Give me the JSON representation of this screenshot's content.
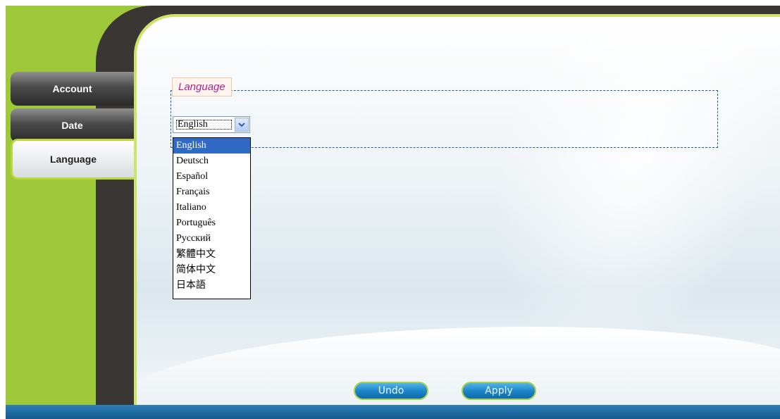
{
  "sidebar": {
    "tabs": [
      {
        "label": "Account",
        "active": false
      },
      {
        "label": "Date",
        "active": false
      },
      {
        "label": "Language",
        "active": true
      }
    ]
  },
  "language_section": {
    "legend": "Language",
    "select": {
      "selected_value": "English",
      "options": [
        "English",
        "Deutsch",
        "Español",
        "Français",
        "Italiano",
        "Português",
        "Русский",
        "繁體中文",
        "简体中文",
        "日本語"
      ],
      "expanded": true
    }
  },
  "buttons": {
    "undo_label": "Undo",
    "apply_label": "Apply"
  },
  "colors": {
    "frame_green": "#9cc83a",
    "dark_band": "#3a3633",
    "fieldset_border": "#1c5fa8",
    "legend_text": "#b0208a",
    "selection_blue": "#316ac5",
    "button_blue": "#1c83c7"
  }
}
